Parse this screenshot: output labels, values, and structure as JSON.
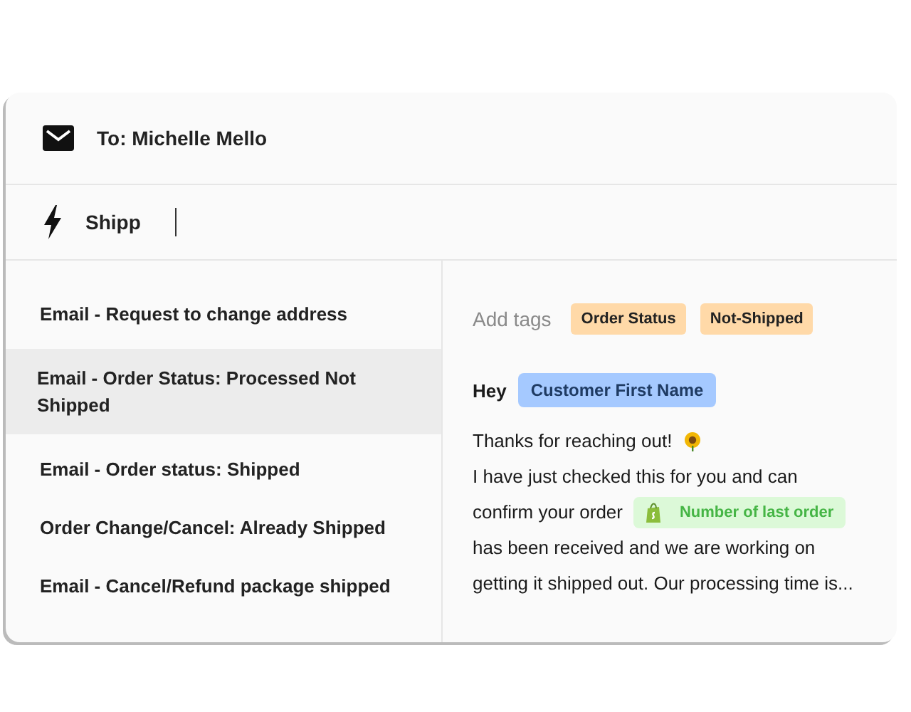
{
  "recipient": {
    "text": "To: Michelle Mello"
  },
  "search": {
    "value": "Shipp"
  },
  "templates": [
    {
      "label": "Email - Request to change address",
      "selected": false
    },
    {
      "label": "Email - Order Status: Processed Not Shipped",
      "selected": true
    },
    {
      "label": "Email - Order status: Shipped",
      "selected": false
    },
    {
      "label": "Order Change/Cancel: Already Shipped",
      "selected": false
    },
    {
      "label": "Email - Cancel/Refund package shipped",
      "selected": false
    }
  ],
  "preview": {
    "tags_label": "Add tags",
    "tags": [
      {
        "text": "Order Status",
        "color": "#ffd9a8"
      },
      {
        "text": "Not-Shipped",
        "color": "#ffd9a8"
      }
    ],
    "lines": [
      [
        {
          "kind": "greeting",
          "text": "Hey"
        },
        {
          "kind": "variable",
          "text": "Customer First Name",
          "color": "#a5c9ff"
        }
      ],
      [
        {
          "kind": "text",
          "text": "Thanks for reaching out!"
        },
        {
          "kind": "emoji"
        }
      ],
      [
        {
          "kind": "text",
          "text": "I have just checked this for you and can"
        }
      ],
      [
        {
          "kind": "text",
          "text": "confirm your order"
        },
        {
          "kind": "shop-variable",
          "text": "Number of last order",
          "color": "#dcf9d8"
        }
      ],
      [
        {
          "kind": "text",
          "text": "has been received and we are working on"
        }
      ],
      [
        {
          "kind": "text",
          "text": "getting it shipped out. Our processing time is..."
        }
      ]
    ]
  }
}
